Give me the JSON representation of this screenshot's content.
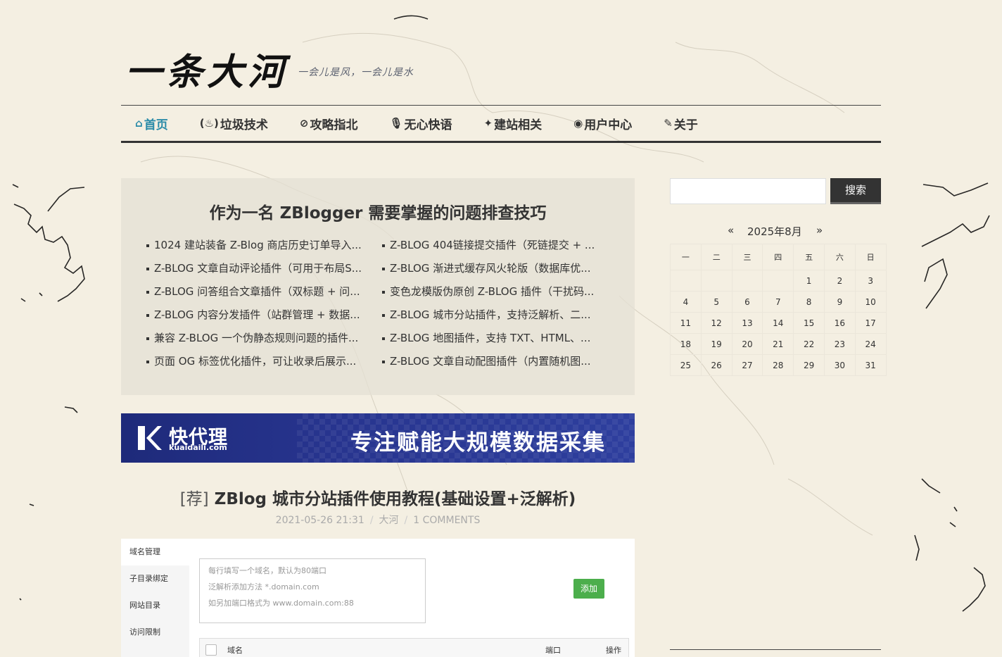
{
  "site": {
    "logo": "一条大河",
    "tagline": "一会儿是风，一会儿是水"
  },
  "nav": {
    "items": [
      {
        "icon": "⌂",
        "icon_name": "home-icon",
        "label": "首页",
        "active": true
      },
      {
        "icon": "(♨)",
        "icon_name": "fire-icon",
        "label": "垃圾技术"
      },
      {
        "icon": "⊘",
        "icon_name": "compass-icon",
        "label": "攻略指北"
      },
      {
        "icon": "🎙",
        "icon_name": "microphone-icon",
        "label": "无心快语"
      },
      {
        "icon": "✦",
        "icon_name": "cubes-icon",
        "label": "建站相关"
      },
      {
        "icon": "◉",
        "icon_name": "user-circle-icon",
        "label": "用户中心"
      },
      {
        "icon": "✎",
        "icon_name": "about-icon",
        "label": "关于"
      }
    ]
  },
  "feature": {
    "title": "作为一名 ZBlogger 需要掌握的问题排查技巧",
    "items": [
      "1024 建站装备 Z-Blog 商店历史订单导入...",
      "Z-BLOG 404链接提交插件（死链提交 + ...",
      "Z-BLOG 文章自动评论插件（可用于布局S...",
      "Z-BLOG 渐进式缓存风火轮版（数据库优...",
      "Z-BLOG 问答组合文章插件（双标题 + 问...",
      "变色龙模版伪原创 Z-BLOG 插件（干扰码...",
      "Z-BLOG 内容分发插件（站群管理 + 数据...",
      "Z-BLOG 城市分站插件，支持泛解析、二...",
      "兼容 Z-BLOG 一个伪静态规则问题的插件...",
      "Z-BLOG 地图插件，支持 TXT、HTML、...",
      "页面 OG 标签优化插件，可让收录后展示...",
      "Z-BLOG 文章自动配图插件（内置随机图..."
    ]
  },
  "banner": {
    "brand": "快代理",
    "domain": "kuaidaili.com",
    "slogan": "专注赋能大规模数据采集"
  },
  "post": {
    "tag": "[荐]",
    "title": "ZBlog 城市分站插件使用教程(基础设置+泛解析)",
    "date": "2021-05-26 21:31",
    "author": "大河",
    "comments": "1 COMMENTS",
    "screenshot": {
      "sidebar": [
        "域名管理",
        "子目录绑定",
        "网站目录",
        "访问限制"
      ],
      "textarea_lines": [
        "每行填写一个域名，默认为80端口",
        "泛解析添加方法 *.domain.com",
        "如另加端口格式为 www.domain.com:88"
      ],
      "add_button": "添加",
      "table_headers": [
        "域名",
        "端口",
        "操作"
      ]
    }
  },
  "sidebar": {
    "search_button": "搜索",
    "search_value": "",
    "calendar": {
      "prev": "«",
      "month": "2025年8月",
      "next": "»",
      "weekdays": [
        "一",
        "二",
        "三",
        "四",
        "五",
        "六",
        "日"
      ],
      "weeks": [
        [
          "",
          "",
          "",
          "",
          "1",
          "2",
          "3"
        ],
        [
          "4",
          "5",
          "6",
          "7",
          "8",
          "9",
          "10"
        ],
        [
          "11",
          "12",
          "13",
          "14",
          "15",
          "16",
          "17"
        ],
        [
          "18",
          "19",
          "20",
          "21",
          "22",
          "23",
          "24"
        ],
        [
          "25",
          "26",
          "27",
          "28",
          "29",
          "30",
          "31"
        ]
      ]
    }
  }
}
